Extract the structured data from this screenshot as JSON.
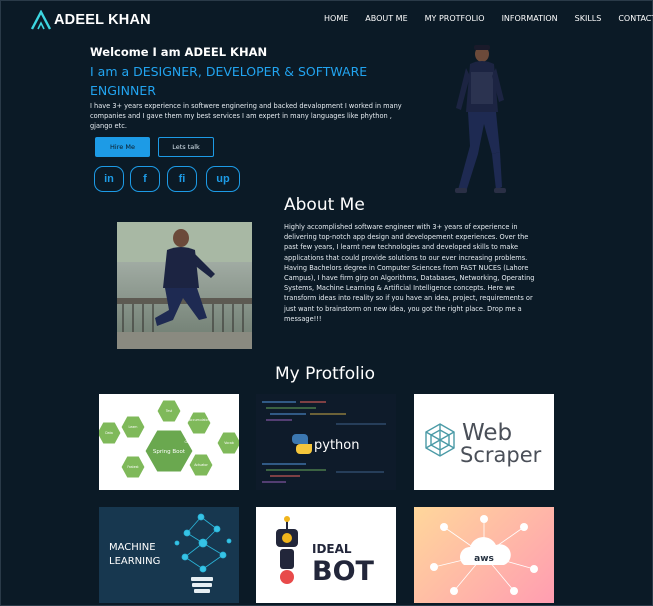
{
  "logo": {
    "text": "ADEEL KHAN"
  },
  "nav": [
    "HOME",
    "ABOUT ME",
    "MY PROTFOLIO",
    "INFORMATION",
    "SKILLS",
    "CONTACT"
  ],
  "hero": {
    "welcome": "Welcome I am ADEEL KHAN",
    "role": "I am a DESIGNER, DEVELOPER & SOFTWARE ENGINNER",
    "intro": "I have 3+ years experience in softwere enginering and backed devalopment I worked in many companies and I gave them my best services I am expert in many languages like phython , gjango etc.",
    "hire_label": "Hire Me",
    "talk_label": "Lets talk",
    "social": [
      "in",
      "f",
      "fi",
      "up"
    ]
  },
  "about": {
    "title": "About Me",
    "text": "Highly accomplished software engineer with 3+ years of experience in delivering top-notch app design and developement experiences. Over the past few years, I learnt new technologies and developed skills to make applications that could provide solutions to our ever increasing problems. Having Bachelors degree in Computer Sciences from FAST NUCES (Lahore Campus), I have firm girp on Algorithms, Databases, Networking, Operating Systems, Machine Learning & Artificial Intelligence concepts. Here we transform ideas into reality so if you have an idea, project, requirements or just want to brainstorm on new idea, you got the right place. Drop me a message!!!"
  },
  "portfolio": {
    "title": "My Protfolio",
    "cards": {
      "spring": {
        "center": "Spring Boot",
        "labels": [
          "Test",
          "Accumulator",
          "Learn",
          "Data",
          "Good Architecture",
          "Vocab",
          "Security Performance",
          "Actuator",
          "Fastest"
        ]
      },
      "python": {
        "label": "python"
      },
      "webscraper": {
        "line1": "Web",
        "line2": "Scraper"
      },
      "ml": {
        "line1": "MACHINE",
        "line2": "LEARNING"
      },
      "idealbot": {
        "line1": "IDEAL",
        "line2": "BOT"
      },
      "aws": {
        "label": "aws"
      }
    }
  },
  "colors": {
    "background": "#0b1a26",
    "accent": "#1d9be6",
    "role_text": "#22a4f0"
  }
}
